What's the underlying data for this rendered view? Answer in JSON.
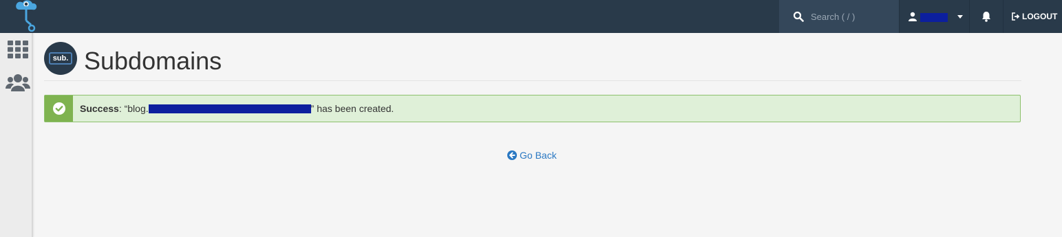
{
  "header": {
    "logo_icon": "cloud-logo-icon",
    "search": {
      "placeholder": "Search ( / )",
      "icon": "search-icon"
    },
    "user": {
      "icon": "user-icon"
    },
    "notifications_icon": "bell-icon",
    "logout_label": "LOGOUT"
  },
  "sidebar": {
    "items": [
      {
        "icon": "grid-icon"
      },
      {
        "icon": "users-icon"
      }
    ]
  },
  "page": {
    "title": "Subdomains",
    "icon_badge": "sub."
  },
  "alert": {
    "type": "success",
    "label": "Success",
    "prefix": ": “blog.",
    "suffix": "” has been created."
  },
  "go_back_label": "Go Back",
  "colors": {
    "topbar": "#293a4a",
    "success_bg": "#dff0d8",
    "success_icon": "#7fb350",
    "link": "#2a78c2"
  }
}
